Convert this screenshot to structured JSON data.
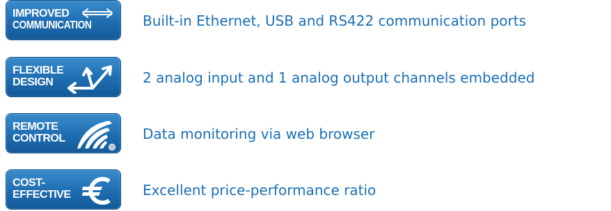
{
  "features": [
    {
      "badge_line1": "IMPROVED",
      "badge_line2": "COMMUNICATION",
      "icon": "double-arrow-icon",
      "text": "Built-in Ethernet, USB and RS422 communication ports"
    },
    {
      "badge_line1": "FLEXIBLE",
      "badge_line2": "DESIGN",
      "icon": "multi-direction-arrows-icon",
      "text": "2 analog input and 1 analog output channels embedded"
    },
    {
      "badge_line1": "REMOTE",
      "badge_line2": "CONTROL",
      "icon": "wireless-signal-icon",
      "text": "Data monitoring via web browser"
    },
    {
      "badge_line1": "COST-",
      "badge_line2": "EFFECTIVE",
      "icon": "euro-icon",
      "text": "Excellent price-performance ratio"
    }
  ],
  "colors": {
    "badge_blue": "#1f6db1",
    "text_blue": "#1a6fb5"
  }
}
